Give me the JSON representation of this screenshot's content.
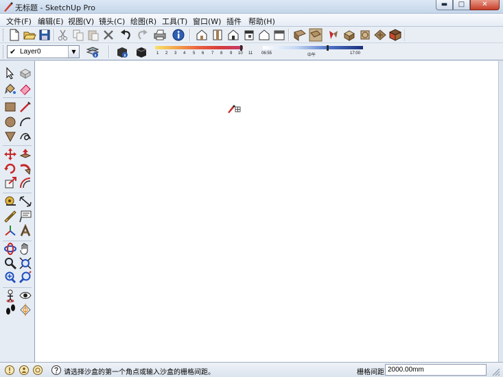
{
  "window": {
    "title": "无标题 - SketchUp Pro",
    "minimize_glyph": "▬",
    "maximize_glyph": "□",
    "close_glyph": "✕"
  },
  "menu": [
    "文件(F)",
    "编辑(E)",
    "视图(V)",
    "镜头(C)",
    "绘图(R)",
    "工具(T)",
    "窗口(W)",
    "插件",
    "帮助(H)"
  ],
  "toolbar": {
    "icons": [
      "new-file-icon",
      "open-file-icon",
      "save-icon",
      "cut-icon",
      "copy-icon",
      "paste-icon",
      "erase-icon",
      "undo-icon",
      "redo-icon",
      "print-icon",
      "model-info-icon",
      "iso-view-icon",
      "top-view-icon",
      "front-view-icon",
      "right-view-icon",
      "back-view-icon",
      "left-view-icon",
      "xray-icon",
      "wireframe-icon",
      "hidden-line-icon",
      "shaded-icon",
      "shaded-textures-icon",
      "monochrome-icon"
    ]
  },
  "layers": {
    "checkmark": "✔",
    "current": "Layer0",
    "dropdown_glyph": "▼"
  },
  "shadows": {
    "hour_ticks": [
      "1",
      "2",
      "3",
      "4",
      "5",
      "6",
      "7",
      "8",
      "9",
      "10",
      "11"
    ],
    "time_start": "06:55",
    "midday": "中午",
    "time_end": "17:00",
    "time_position": 0.98
  },
  "palette": {
    "tools": [
      "select-icon",
      "make-component-icon",
      "paint-bucket-icon",
      "eraser-icon",
      "rectangle-icon",
      "line-icon",
      "circle-icon",
      "arc-icon",
      "polygon-icon",
      "freehand-icon",
      "move-icon",
      "push-pull-icon",
      "rotate-icon",
      "follow-me-icon",
      "scale-icon",
      "offset-icon",
      "tape-measure-icon",
      "dimension-icon",
      "protractor-icon",
      "text-icon",
      "axes-icon",
      "3d-text-icon",
      "orbit-icon",
      "pan-icon",
      "zoom-icon",
      "zoom-window-icon",
      "zoom-extents-icon",
      "previous-view-icon",
      "position-camera-icon",
      "look-around-icon",
      "walk-icon",
      "section-plane-icon"
    ]
  },
  "status": {
    "hint": "请选择沙盒的第一个角点或输入沙盒的栅格间距。",
    "measure_label": "栅格间距",
    "measure_value": "2000.00mm"
  },
  "colors": {
    "canvas": "#ffffff",
    "chrome": "#e9eef5",
    "title_close": "#c6402a"
  }
}
